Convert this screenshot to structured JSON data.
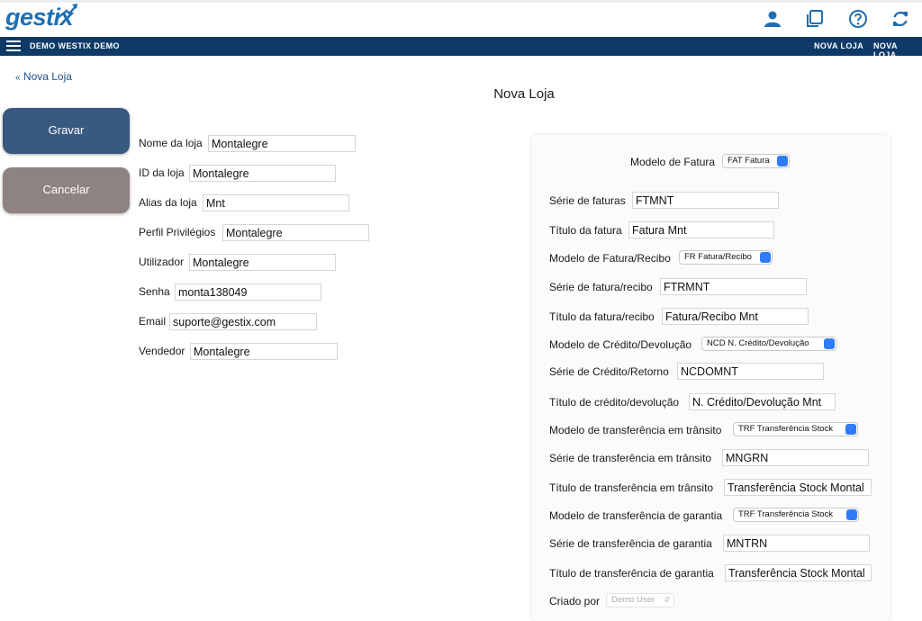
{
  "header": {
    "logo_text": "gestix",
    "icons": [
      "user-icon",
      "copy-icon",
      "help-icon",
      "refresh-icon"
    ],
    "accent": "#1f6fb2"
  },
  "navbar": {
    "title": "DEMO WESTIX DEMO",
    "right_items": [
      "NOVA LOJA",
      "NOVA LOJA"
    ],
    "color": "#0f3a67"
  },
  "back_link": "Nova Loja",
  "page_title": "Nova Loja",
  "buttons": {
    "save": "Gravar",
    "cancel": "Cancelar"
  },
  "left_form": [
    {
      "label": "Nome da loja",
      "value": "Montalegre"
    },
    {
      "label": "ID da loja",
      "value": "Montalegre"
    },
    {
      "label": "Alias da loja",
      "value": "Mnt"
    },
    {
      "label": "Perfil Privilégios",
      "value": "Montalegre"
    },
    {
      "label": "Utilizador",
      "value": "Montalegre"
    },
    {
      "label": "Senha",
      "value": "monta138049"
    },
    {
      "label": "Email",
      "value": "suporte@gestix.com"
    },
    {
      "label": "Vendedor",
      "value": "Montalegre"
    }
  ],
  "right_form": {
    "modelo_fatura": {
      "label": "Modelo de Fatura",
      "value": "FAT Fatura"
    },
    "rows": [
      {
        "label": "Série de faturas",
        "type": "input",
        "value": "FTMNT"
      },
      {
        "label": "Título da fatura",
        "type": "input",
        "value": "Fatura Mnt"
      },
      {
        "label": "Modelo de Fatura/Recibo",
        "type": "select",
        "value": "FR Fatura/Recibo"
      },
      {
        "label": "Série de fatura/recibo",
        "type": "input",
        "value": "FTRMNT"
      },
      {
        "label": "Título da fatura/recibo",
        "type": "input",
        "value": "Fatura/Recibo Mnt"
      },
      {
        "label": "Modelo de Crédito/Devolução",
        "type": "select",
        "value": "NCD N. Crédito/Devolução"
      },
      {
        "label": "Série de Crédito/Retorno",
        "type": "input",
        "value": "NCDOMNT"
      },
      {
        "label": "Título de crédito/devolução",
        "type": "input",
        "value": "N. Crédito/Devolução Mnt"
      },
      {
        "label": "Modelo de transferência em trânsito",
        "type": "select",
        "value": "TRF Transferência Stock"
      },
      {
        "label": "Série de transferência em trânsito",
        "type": "input",
        "value": "MNGRN"
      },
      {
        "label": "Título de transferência em trânsito",
        "type": "input",
        "value": "Transferência Stock Montal"
      },
      {
        "label": "Modelo de transferência de garantia",
        "type": "select",
        "value": "TRF Transferência Stock"
      },
      {
        "label": "Série de transferência de garantia",
        "type": "input",
        "value": "MNTRN"
      },
      {
        "label": "Título de transferência de garantia",
        "type": "input",
        "value": "Transferência Stock Montal"
      },
      {
        "label": "Criado por",
        "type": "select-disabled",
        "value": "Demo User"
      }
    ]
  }
}
